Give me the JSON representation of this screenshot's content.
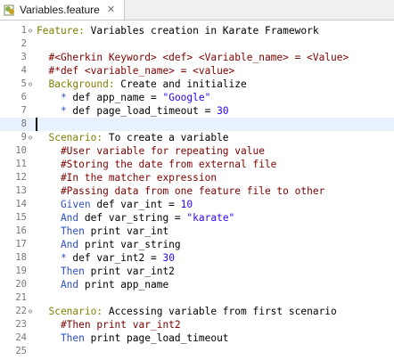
{
  "tab": {
    "title": "Variables.feature",
    "close_glyph": "✕",
    "icon": "feature-file-icon"
  },
  "lines": [
    {
      "n": "1",
      "fold": "⊖",
      "parts": [
        [
          "ftr",
          "Feature:"
        ],
        [
          "plain",
          " Variables creation in Karate Framework"
        ]
      ]
    },
    {
      "n": "2",
      "fold": "",
      "parts": []
    },
    {
      "n": "3",
      "fold": "",
      "parts": [
        [
          "cmt",
          "  #<Gherkin Keyword> <def> <Variable_name> = <Value>"
        ]
      ]
    },
    {
      "n": "4",
      "fold": "",
      "parts": [
        [
          "cmt",
          "  #*def <variable_name> = <value>"
        ]
      ]
    },
    {
      "n": "5",
      "fold": "⊖",
      "parts": [
        [
          "ftr",
          "  Background:"
        ],
        [
          "plain",
          " Create and initialize"
        ]
      ]
    },
    {
      "n": "6",
      "fold": "",
      "parts": [
        [
          "step",
          "    * "
        ],
        [
          "plain",
          "def app_name = "
        ],
        [
          "str",
          "\"Google\""
        ]
      ]
    },
    {
      "n": "7",
      "fold": "",
      "parts": [
        [
          "step",
          "    * "
        ],
        [
          "plain",
          "def page_load_timeout = "
        ],
        [
          "num",
          "30"
        ]
      ]
    },
    {
      "n": "8",
      "fold": "",
      "parts": [],
      "current": true
    },
    {
      "n": "9",
      "fold": "⊖",
      "parts": [
        [
          "ftr",
          "  Scenario:"
        ],
        [
          "plain",
          " To create a variable"
        ]
      ]
    },
    {
      "n": "10",
      "fold": "",
      "parts": [
        [
          "cmt",
          "    #User variable for repeating value"
        ]
      ]
    },
    {
      "n": "11",
      "fold": "",
      "parts": [
        [
          "cmt",
          "    #Storing the date from external file"
        ]
      ]
    },
    {
      "n": "12",
      "fold": "",
      "parts": [
        [
          "cmt",
          "    #In the matcher expression"
        ]
      ]
    },
    {
      "n": "13",
      "fold": "",
      "parts": [
        [
          "cmt",
          "    #Passing data from one feature file to other"
        ]
      ]
    },
    {
      "n": "14",
      "fold": "",
      "parts": [
        [
          "step",
          "    Given "
        ],
        [
          "plain",
          "def var_int = "
        ],
        [
          "num",
          "10"
        ]
      ]
    },
    {
      "n": "15",
      "fold": "",
      "parts": [
        [
          "step",
          "    And "
        ],
        [
          "plain",
          "def var_string = "
        ],
        [
          "str",
          "\"karate\""
        ]
      ]
    },
    {
      "n": "16",
      "fold": "",
      "parts": [
        [
          "step",
          "    Then "
        ],
        [
          "plain",
          "print var_int"
        ]
      ]
    },
    {
      "n": "17",
      "fold": "",
      "parts": [
        [
          "step",
          "    And "
        ],
        [
          "plain",
          "print var_string"
        ]
      ]
    },
    {
      "n": "18",
      "fold": "",
      "parts": [
        [
          "step",
          "    * "
        ],
        [
          "plain",
          "def var_int2 = "
        ],
        [
          "num",
          "30"
        ]
      ]
    },
    {
      "n": "19",
      "fold": "",
      "parts": [
        [
          "step",
          "    Then "
        ],
        [
          "plain",
          "print var_int2"
        ]
      ]
    },
    {
      "n": "20",
      "fold": "",
      "parts": [
        [
          "step",
          "    And "
        ],
        [
          "plain",
          "print app_name"
        ]
      ]
    },
    {
      "n": "21",
      "fold": "",
      "parts": []
    },
    {
      "n": "22",
      "fold": "⊖",
      "parts": [
        [
          "ftr",
          "  Scenario:"
        ],
        [
          "plain",
          " Accessing variable from first scenario"
        ]
      ]
    },
    {
      "n": "23",
      "fold": "",
      "parts": [
        [
          "cmt",
          "    #Then print var_int2"
        ]
      ]
    },
    {
      "n": "24",
      "fold": "",
      "parts": [
        [
          "step",
          "    Then "
        ],
        [
          "plain",
          "print page_load_timeout"
        ]
      ]
    },
    {
      "n": "25",
      "fold": "",
      "parts": []
    }
  ],
  "colors": {
    "keyword": "#7f7f00",
    "comment": "#7f0000",
    "step": "#2a4fc1",
    "string": "#2a00ff",
    "current_line": "#e8f2fe"
  }
}
